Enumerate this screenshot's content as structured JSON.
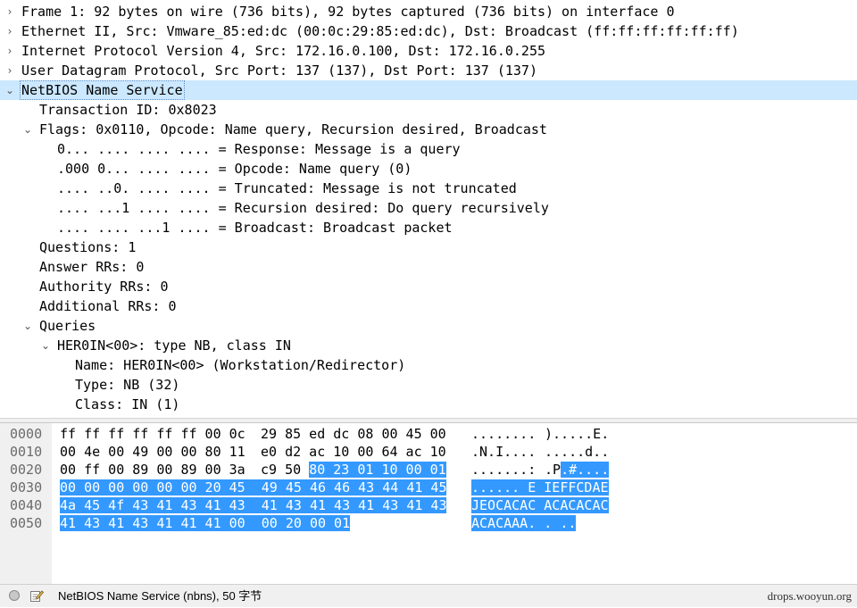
{
  "details": [
    {
      "arrow": "›",
      "text": "Frame 1: 92 bytes on wire (736 bits), 92 bytes captured (736 bits) on interface 0"
    },
    {
      "arrow": "›",
      "text": "Ethernet II, Src: Vmware_85:ed:dc (00:0c:29:85:ed:dc), Dst: Broadcast (ff:ff:ff:ff:ff:ff)"
    },
    {
      "arrow": "›",
      "text": "Internet Protocol Version 4, Src: 172.16.0.100, Dst: 172.16.0.255"
    },
    {
      "arrow": "›",
      "text": "User Datagram Protocol, Src Port: 137 (137), Dst Port: 137 (137)"
    },
    {
      "arrow": "⌄",
      "text": "NetBIOS Name Service"
    },
    {
      "arrow": "",
      "text": "Transaction ID: 0x8023"
    },
    {
      "arrow": "⌄",
      "text": "Flags: 0x0110, Opcode: Name query, Recursion desired, Broadcast"
    },
    {
      "arrow": "",
      "text": "0... .... .... .... = Response: Message is a query"
    },
    {
      "arrow": "",
      "text": ".000 0... .... .... = Opcode: Name query (0)"
    },
    {
      "arrow": "",
      "text": ".... ..0. .... .... = Truncated: Message is not truncated"
    },
    {
      "arrow": "",
      "text": ".... ...1 .... .... = Recursion desired: Do query recursively"
    },
    {
      "arrow": "",
      "text": ".... .... ...1 .... = Broadcast: Broadcast packet"
    },
    {
      "arrow": "",
      "text": "Questions: 1"
    },
    {
      "arrow": "",
      "text": "Answer RRs: 0"
    },
    {
      "arrow": "",
      "text": "Authority RRs: 0"
    },
    {
      "arrow": "",
      "text": "Additional RRs: 0"
    },
    {
      "arrow": "⌄",
      "text": "Queries"
    },
    {
      "arrow": "⌄",
      "text": "HER0IN<00>: type NB, class IN"
    },
    {
      "arrow": "",
      "text": "Name: HER0IN<00> (Workstation/Redirector)"
    },
    {
      "arrow": "",
      "text": "Type: NB (32)"
    },
    {
      "arrow": "",
      "text": "Class: IN (1)"
    }
  ],
  "hex": {
    "rows": [
      {
        "offset": "0000",
        "bytes_a": "ff ff ff ff ff ff 00 0c",
        "bytes_b": "29 85 ed dc 08 00 45 00",
        "ascii_a": "........",
        "ascii_b": ").....E."
      },
      {
        "offset": "0010",
        "bytes_a": "00 4e 00 49 00 00 80 11",
        "bytes_b": "e0 d2 ac 10 00 64 ac 10",
        "ascii_a": ".N.I....",
        "ascii_b": ".....d.."
      },
      {
        "offset": "0020",
        "bytes_a": "00 ff 00 89 00 89 00 3a",
        "bytes_b": "c9 50 80 23 01 10 00 01",
        "ascii_a": ".......:",
        "ascii_b": ".P.#...."
      },
      {
        "offset": "0030",
        "bytes_a": "00 00 00 00 00 00 20 45",
        "bytes_b": "49 45 46 46 43 44 41 45",
        "ascii_a": "...... E",
        "ascii_b": "IEFFCDAE"
      },
      {
        "offset": "0040",
        "bytes_a": "4a 45 4f 43 41 43 41 43",
        "bytes_b": "41 43 41 43 41 43 41 43",
        "ascii_a": "JEOCACAC",
        "ascii_b": "ACACACAC"
      },
      {
        "offset": "0050",
        "bytes_a": "41 43 41 43 41 41 41 00",
        "bytes_b": "00 20 00 01",
        "ascii_a": "ACACAAA.",
        "ascii_b": ". .."
      }
    ]
  },
  "status": {
    "text": "NetBIOS Name Service (nbns), 50 字节",
    "watermark": "drops.wooyun.org"
  },
  "colors": {
    "selected_row": "#cce8ff",
    "hex_highlight": "#3399ff",
    "pane_gray": "#f0f0f0"
  },
  "icons": [
    "chevron-right-icon",
    "chevron-down-icon",
    "expert-info-icon",
    "edit-comment-icon"
  ]
}
